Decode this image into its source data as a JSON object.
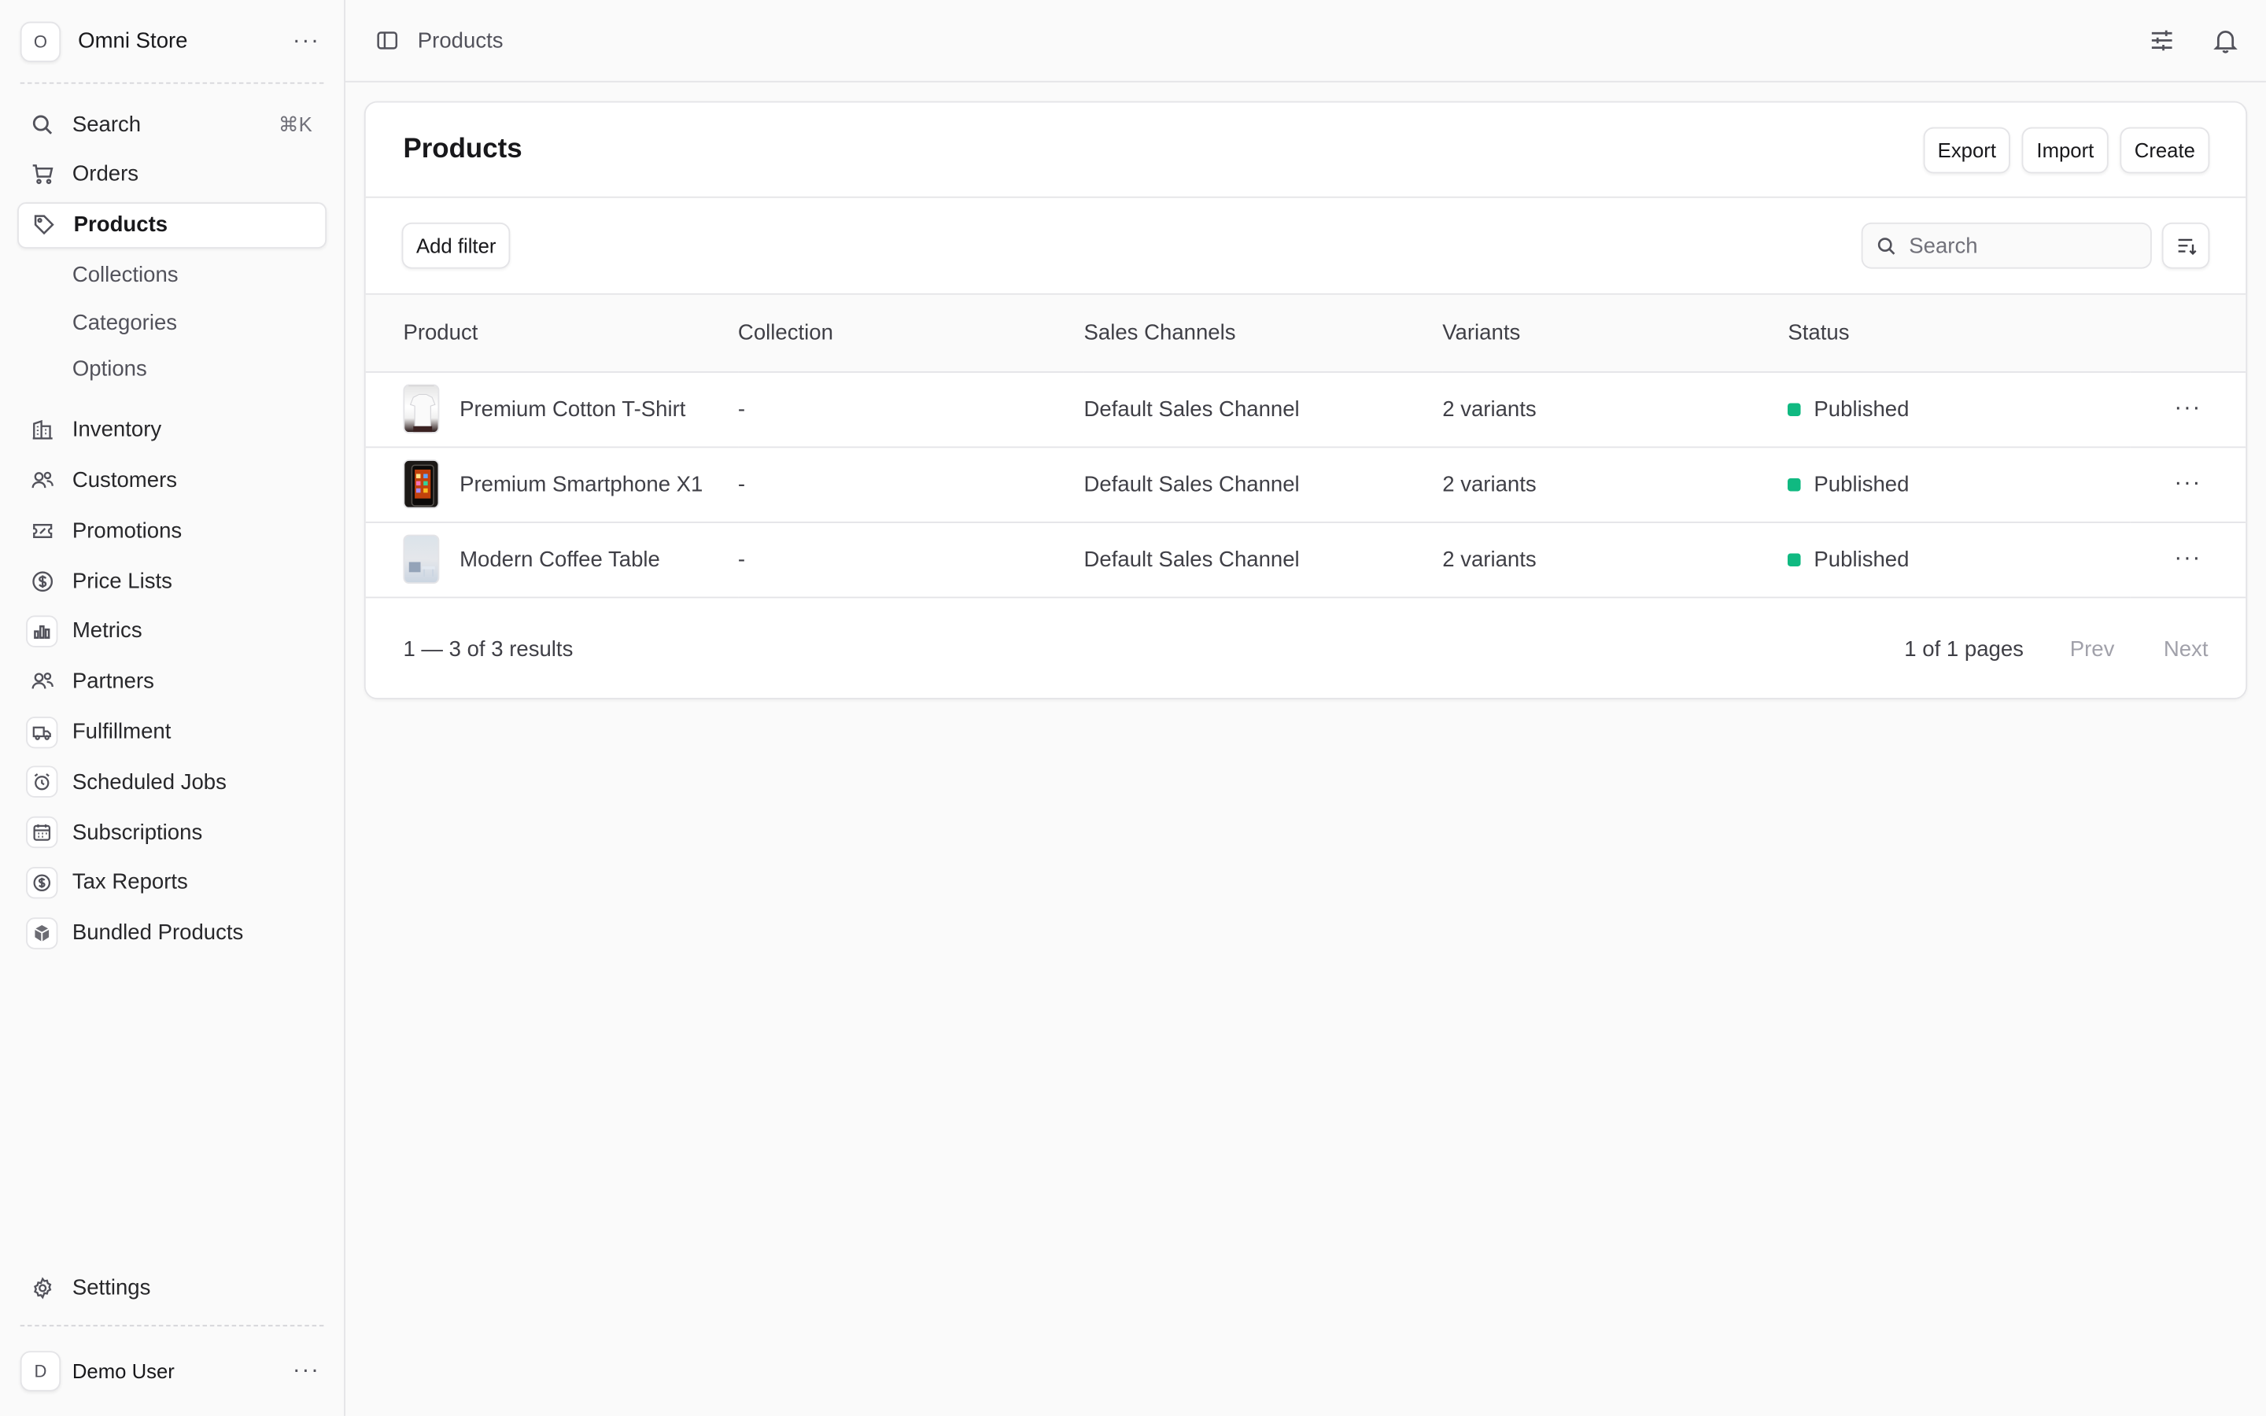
{
  "store": {
    "initial": "O",
    "name": "Omni Store"
  },
  "nav": {
    "search_label": "Search",
    "search_shortcut": "⌘K",
    "orders": "Orders",
    "products": "Products",
    "sub": [
      "Collections",
      "Categories",
      "Options"
    ],
    "extensions": [
      "Inventory",
      "Customers",
      "Promotions",
      "Price Lists",
      "Metrics",
      "Partners",
      "Fulfillment",
      "Scheduled Jobs",
      "Subscriptions",
      "Tax Reports",
      "Bundled Products"
    ],
    "settings": "Settings"
  },
  "user": {
    "initial": "D",
    "name": "Demo User"
  },
  "topbar": {
    "breadcrumb": "Products"
  },
  "page": {
    "title": "Products",
    "actions": {
      "export": "Export",
      "import": "Import",
      "create": "Create"
    },
    "add_filter": "Add filter",
    "search_placeholder": "Search"
  },
  "table": {
    "columns": [
      "Product",
      "Collection",
      "Sales Channels",
      "Variants",
      "Status"
    ],
    "rows": [
      {
        "product": "Premium Cotton T-Shirt",
        "collection": "-",
        "channels": "Default Sales Channel",
        "variants": "2 variants",
        "status": "Published"
      },
      {
        "product": "Premium Smartphone X1",
        "collection": "-",
        "channels": "Default Sales Channel",
        "variants": "2 variants",
        "status": "Published"
      },
      {
        "product": "Modern Coffee Table",
        "collection": "-",
        "channels": "Default Sales Channel",
        "variants": "2 variants",
        "status": "Published"
      }
    ]
  },
  "pagination": {
    "summary": "1 — 3 of 3 results",
    "pages": "1 of 1 pages",
    "prev": "Prev",
    "next": "Next"
  },
  "colors": {
    "status_published": "#10b981",
    "accent": "#18181b",
    "border": "#e4e4e7"
  }
}
